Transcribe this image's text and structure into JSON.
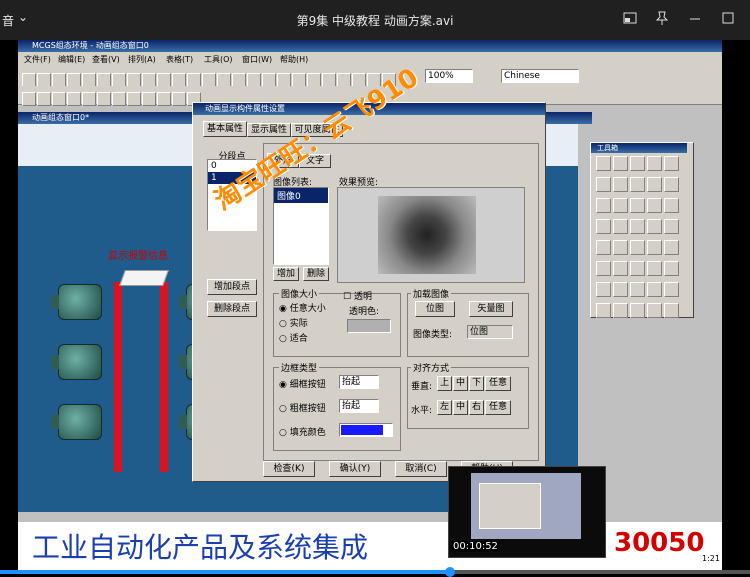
{
  "player": {
    "title": "第9集 中级教程 动画方案.avi",
    "left_fragment": "音",
    "chevron": "⌄"
  },
  "app": {
    "title": "MCGS组态环境 - 动画组态窗口0",
    "menu": [
      "文件(F)",
      "编辑(E)",
      "查看(V)",
      "排列(A)",
      "表格(T)",
      "工具(O)",
      "窗口(W)",
      "帮助(H)"
    ],
    "zoom": "100%",
    "language": "Chinese",
    "child_window_title": "动画组态窗口0*",
    "alarm_text": "显示报警信息"
  },
  "dialog": {
    "title": "动画显示构件属性设置",
    "tabs": [
      "基本属性",
      "显示属性",
      "可见度属性"
    ],
    "segments_label": "分段点",
    "segments": [
      "0",
      "1"
    ],
    "add_segment": "增加段点",
    "delete_segment": "删除段点",
    "inner_tabs": [
      "外形",
      "文字"
    ],
    "image_list_label": "图像列表:",
    "image_list_items": [
      "图像0"
    ],
    "preview_label": "效果预览:",
    "add": "增加",
    "delete": "删除",
    "image_size_label": "图像大小",
    "size_original": "任意大小",
    "size_real": "实际",
    "size_fit": "适合",
    "transparent_label": "透明",
    "transparent_color_label": "透明色:",
    "load_image_label": "加载图像",
    "bitmap_btn": "位图",
    "vector_btn": "矢量图",
    "image_type_label": "图像类型:",
    "image_type_value": "位图",
    "border_type_label": "边框类型",
    "border_thin": "细框按钮",
    "border_thick": "粗框按钮",
    "fill_color": "填充颜色",
    "raise_value1": "抬起",
    "raise_value2": "抬起",
    "align_label": "对齐方式",
    "vertical_label": "垂直:",
    "horizontal_label": "水平:",
    "v_align": [
      "上",
      "中",
      "下",
      "任意"
    ],
    "h_align": [
      "左",
      "中",
      "右",
      "任意"
    ],
    "footer_buttons": [
      "检查(K)",
      "确认(Y)",
      "取消(C)",
      "帮助(H)"
    ],
    "fill_color_hex": "#1a1aff"
  },
  "toolbox": {
    "title": "工具箱"
  },
  "watermark": {
    "shop": "淘宝旺旺：云飞910"
  },
  "banner": {
    "text": "工业自动化产品及系统集成",
    "phone_tail": "30050",
    "clock": "1:21"
  },
  "thumbnail": {
    "time": "00:10:52"
  },
  "progress": {
    "fraction": 0.6
  }
}
